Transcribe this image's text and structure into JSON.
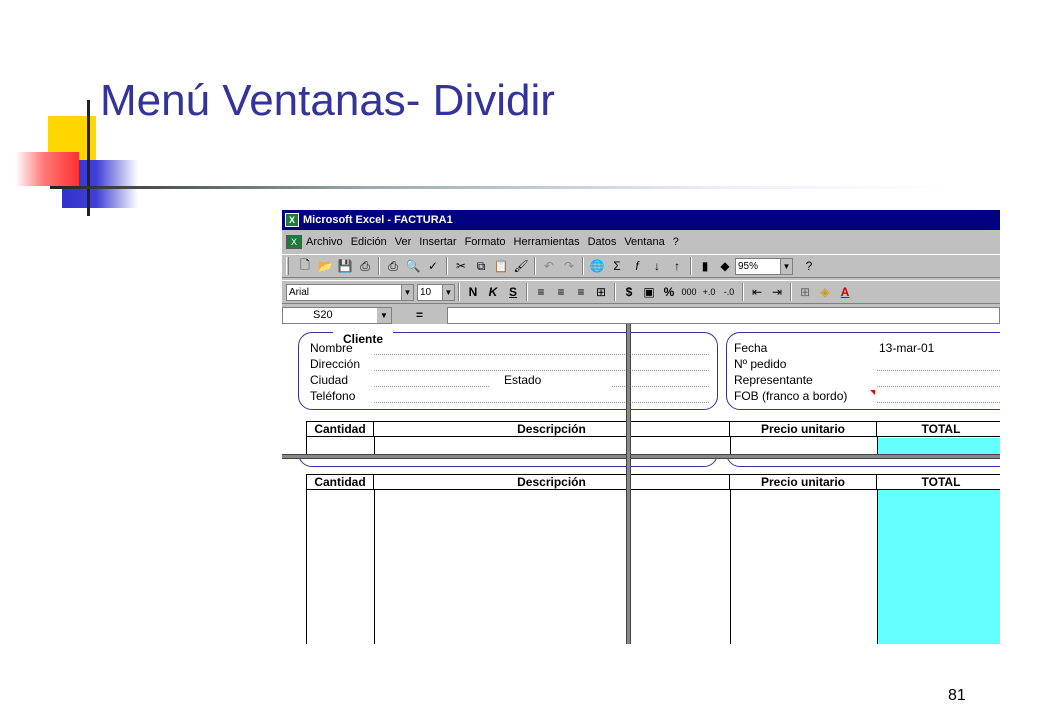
{
  "slide": {
    "title": "Menú Ventanas- Dividir",
    "page_number": "81"
  },
  "excel": {
    "window_title": "Microsoft Excel - FACTURA1",
    "menu": [
      "Archivo",
      "Edición",
      "Ver",
      "Insertar",
      "Formato",
      "Herramientas",
      "Datos",
      "Ventana",
      "?"
    ],
    "toolbar1": {
      "zoom": "95%"
    },
    "toolbar2": {
      "font": "Arial",
      "size": "10",
      "bold": "N",
      "italic": "K",
      "underline": "S",
      "currency": "$",
      "percent": "%",
      "thousands": "000"
    },
    "name_box": "S20",
    "formula_eq": "=",
    "form": {
      "cliente_legend": "Cliente",
      "nombre": "Nombre",
      "direccion": "Dirección",
      "ciudad": "Ciudad",
      "estado": "Estado",
      "telefono": "Teléfono",
      "fecha": "Fecha",
      "fecha_value": "13-mar-01",
      "pedido": "Nº pedido",
      "representante": "Representante",
      "fob": "FOB (franco a bordo)"
    },
    "table": {
      "headers": [
        "Cantidad",
        "Descripción",
        "Precio unitario",
        "TOTAL"
      ]
    }
  }
}
